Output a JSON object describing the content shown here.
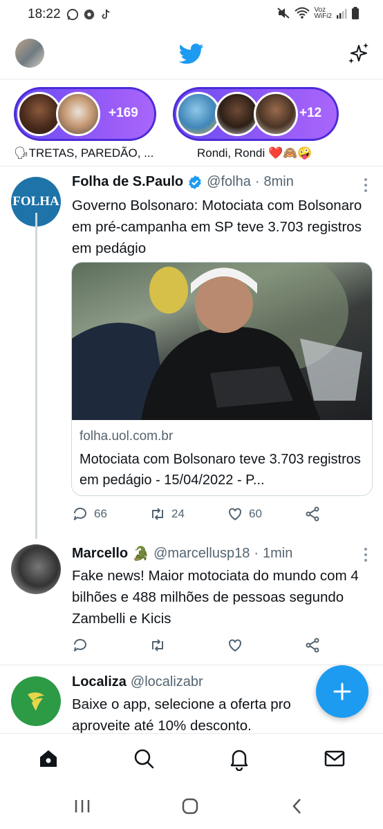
{
  "status_bar": {
    "time": "18:22",
    "carrier_line1": "Voz",
    "carrier_line2": "WiFi2"
  },
  "spaces": [
    {
      "count": "+169",
      "label": "🗣TRETAS, PAREDÃO, ..."
    },
    {
      "count": "+12",
      "label": "Rondi, Rondi ❤️🙈🤪"
    }
  ],
  "tweets": [
    {
      "name": "Folha de S.Paulo",
      "verified": true,
      "handle": "@folha",
      "time": "8min",
      "avatar_text": "FOLHA",
      "text": "Governo Bolsonaro: Motociata com Bolsonaro em pré-campanha em SP teve 3.703 registros em pedágio",
      "card": {
        "domain": "folha.uol.com.br",
        "title": "Motociata com Bolsonaro teve 3.703 registros em pedágio - 15/04/2022 - P..."
      },
      "replies": "66",
      "retweets": "24",
      "likes": "60"
    },
    {
      "name": "Marcello",
      "emoji": "🐊",
      "handle": "@marcellusp18",
      "time": "1min",
      "text": "Fake news! Maior motociata do mundo com 4 bilhões e 488 milhões de pessoas segundo Zambelli e Kicis"
    },
    {
      "name": "Localiza",
      "handle": "@localizabr",
      "text": "Baixe o app, selecione a oferta pro... aproveite até 10% desconto.",
      "text_line1": "Baixe o app, selecione a oferta pro",
      "text_line2": "aproveite até 10% desconto."
    }
  ],
  "colors": {
    "accent": "#1d9bf0",
    "space_gradient_start": "#6a4cf0",
    "space_gradient_end": "#a866fb",
    "verified": "#1d9bf0",
    "localiza_green": "#1e8c3a"
  },
  "icons": {
    "compose": "plus-icon",
    "nav": [
      "home-icon",
      "search-icon",
      "bell-icon",
      "mail-icon"
    ]
  }
}
